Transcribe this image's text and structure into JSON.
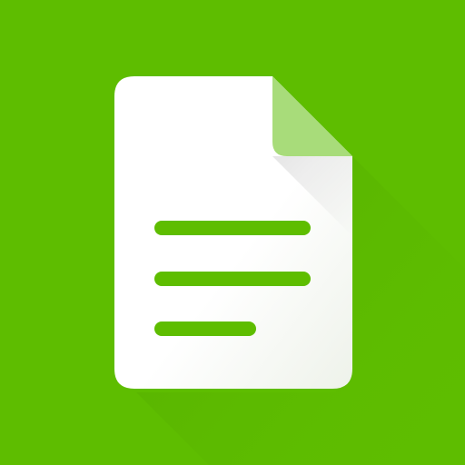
{
  "icon": {
    "name": "document-icon",
    "colors": {
      "background": "#5ebd00",
      "page": "#ffffff",
      "page_shade": "#eef2ea",
      "folded_corner": "#a8dc7a",
      "lines": "#5ebd00",
      "long_shadow": "#4fa300"
    },
    "text_lines": 3
  }
}
